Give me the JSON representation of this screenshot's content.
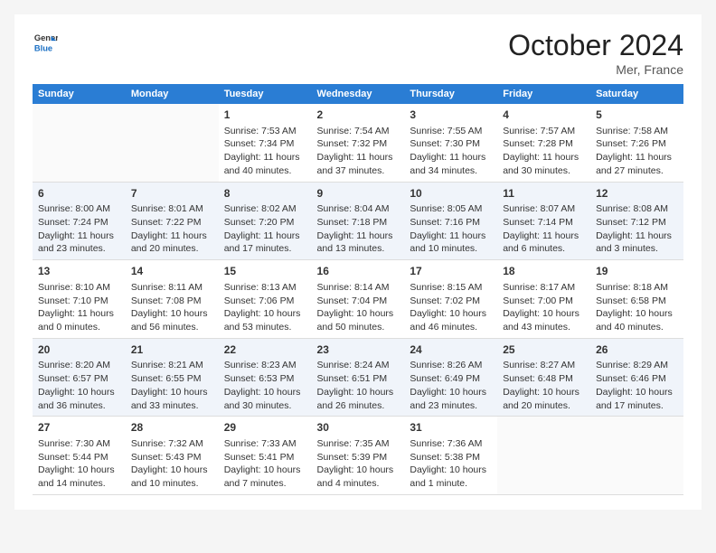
{
  "header": {
    "logo_line1": "General",
    "logo_line2": "Blue",
    "month": "October 2024",
    "location": "Mer, France"
  },
  "days_of_week": [
    "Sunday",
    "Monday",
    "Tuesday",
    "Wednesday",
    "Thursday",
    "Friday",
    "Saturday"
  ],
  "weeks": [
    [
      {
        "day": "",
        "sunrise": "",
        "sunset": "",
        "daylight": ""
      },
      {
        "day": "",
        "sunrise": "",
        "sunset": "",
        "daylight": ""
      },
      {
        "day": "1",
        "sunrise": "Sunrise: 7:53 AM",
        "sunset": "Sunset: 7:34 PM",
        "daylight": "Daylight: 11 hours and 40 minutes."
      },
      {
        "day": "2",
        "sunrise": "Sunrise: 7:54 AM",
        "sunset": "Sunset: 7:32 PM",
        "daylight": "Daylight: 11 hours and 37 minutes."
      },
      {
        "day": "3",
        "sunrise": "Sunrise: 7:55 AM",
        "sunset": "Sunset: 7:30 PM",
        "daylight": "Daylight: 11 hours and 34 minutes."
      },
      {
        "day": "4",
        "sunrise": "Sunrise: 7:57 AM",
        "sunset": "Sunset: 7:28 PM",
        "daylight": "Daylight: 11 hours and 30 minutes."
      },
      {
        "day": "5",
        "sunrise": "Sunrise: 7:58 AM",
        "sunset": "Sunset: 7:26 PM",
        "daylight": "Daylight: 11 hours and 27 minutes."
      }
    ],
    [
      {
        "day": "6",
        "sunrise": "Sunrise: 8:00 AM",
        "sunset": "Sunset: 7:24 PM",
        "daylight": "Daylight: 11 hours and 23 minutes."
      },
      {
        "day": "7",
        "sunrise": "Sunrise: 8:01 AM",
        "sunset": "Sunset: 7:22 PM",
        "daylight": "Daylight: 11 hours and 20 minutes."
      },
      {
        "day": "8",
        "sunrise": "Sunrise: 8:02 AM",
        "sunset": "Sunset: 7:20 PM",
        "daylight": "Daylight: 11 hours and 17 minutes."
      },
      {
        "day": "9",
        "sunrise": "Sunrise: 8:04 AM",
        "sunset": "Sunset: 7:18 PM",
        "daylight": "Daylight: 11 hours and 13 minutes."
      },
      {
        "day": "10",
        "sunrise": "Sunrise: 8:05 AM",
        "sunset": "Sunset: 7:16 PM",
        "daylight": "Daylight: 11 hours and 10 minutes."
      },
      {
        "day": "11",
        "sunrise": "Sunrise: 8:07 AM",
        "sunset": "Sunset: 7:14 PM",
        "daylight": "Daylight: 11 hours and 6 minutes."
      },
      {
        "day": "12",
        "sunrise": "Sunrise: 8:08 AM",
        "sunset": "Sunset: 7:12 PM",
        "daylight": "Daylight: 11 hours and 3 minutes."
      }
    ],
    [
      {
        "day": "13",
        "sunrise": "Sunrise: 8:10 AM",
        "sunset": "Sunset: 7:10 PM",
        "daylight": "Daylight: 11 hours and 0 minutes."
      },
      {
        "day": "14",
        "sunrise": "Sunrise: 8:11 AM",
        "sunset": "Sunset: 7:08 PM",
        "daylight": "Daylight: 10 hours and 56 minutes."
      },
      {
        "day": "15",
        "sunrise": "Sunrise: 8:13 AM",
        "sunset": "Sunset: 7:06 PM",
        "daylight": "Daylight: 10 hours and 53 minutes."
      },
      {
        "day": "16",
        "sunrise": "Sunrise: 8:14 AM",
        "sunset": "Sunset: 7:04 PM",
        "daylight": "Daylight: 10 hours and 50 minutes."
      },
      {
        "day": "17",
        "sunrise": "Sunrise: 8:15 AM",
        "sunset": "Sunset: 7:02 PM",
        "daylight": "Daylight: 10 hours and 46 minutes."
      },
      {
        "day": "18",
        "sunrise": "Sunrise: 8:17 AM",
        "sunset": "Sunset: 7:00 PM",
        "daylight": "Daylight: 10 hours and 43 minutes."
      },
      {
        "day": "19",
        "sunrise": "Sunrise: 8:18 AM",
        "sunset": "Sunset: 6:58 PM",
        "daylight": "Daylight: 10 hours and 40 minutes."
      }
    ],
    [
      {
        "day": "20",
        "sunrise": "Sunrise: 8:20 AM",
        "sunset": "Sunset: 6:57 PM",
        "daylight": "Daylight: 10 hours and 36 minutes."
      },
      {
        "day": "21",
        "sunrise": "Sunrise: 8:21 AM",
        "sunset": "Sunset: 6:55 PM",
        "daylight": "Daylight: 10 hours and 33 minutes."
      },
      {
        "day": "22",
        "sunrise": "Sunrise: 8:23 AM",
        "sunset": "Sunset: 6:53 PM",
        "daylight": "Daylight: 10 hours and 30 minutes."
      },
      {
        "day": "23",
        "sunrise": "Sunrise: 8:24 AM",
        "sunset": "Sunset: 6:51 PM",
        "daylight": "Daylight: 10 hours and 26 minutes."
      },
      {
        "day": "24",
        "sunrise": "Sunrise: 8:26 AM",
        "sunset": "Sunset: 6:49 PM",
        "daylight": "Daylight: 10 hours and 23 minutes."
      },
      {
        "day": "25",
        "sunrise": "Sunrise: 8:27 AM",
        "sunset": "Sunset: 6:48 PM",
        "daylight": "Daylight: 10 hours and 20 minutes."
      },
      {
        "day": "26",
        "sunrise": "Sunrise: 8:29 AM",
        "sunset": "Sunset: 6:46 PM",
        "daylight": "Daylight: 10 hours and 17 minutes."
      }
    ],
    [
      {
        "day": "27",
        "sunrise": "Sunrise: 7:30 AM",
        "sunset": "Sunset: 5:44 PM",
        "daylight": "Daylight: 10 hours and 14 minutes."
      },
      {
        "day": "28",
        "sunrise": "Sunrise: 7:32 AM",
        "sunset": "Sunset: 5:43 PM",
        "daylight": "Daylight: 10 hours and 10 minutes."
      },
      {
        "day": "29",
        "sunrise": "Sunrise: 7:33 AM",
        "sunset": "Sunset: 5:41 PM",
        "daylight": "Daylight: 10 hours and 7 minutes."
      },
      {
        "day": "30",
        "sunrise": "Sunrise: 7:35 AM",
        "sunset": "Sunset: 5:39 PM",
        "daylight": "Daylight: 10 hours and 4 minutes."
      },
      {
        "day": "31",
        "sunrise": "Sunrise: 7:36 AM",
        "sunset": "Sunset: 5:38 PM",
        "daylight": "Daylight: 10 hours and 1 minute."
      },
      {
        "day": "",
        "sunrise": "",
        "sunset": "",
        "daylight": ""
      },
      {
        "day": "",
        "sunrise": "",
        "sunset": "",
        "daylight": ""
      }
    ]
  ]
}
